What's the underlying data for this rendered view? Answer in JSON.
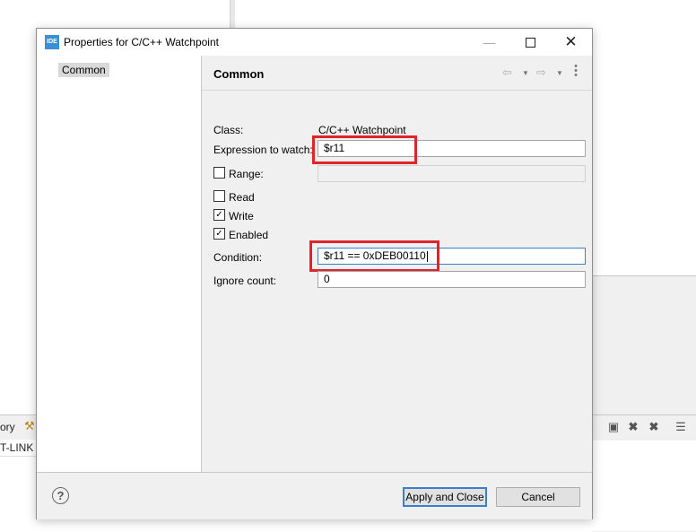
{
  "background": {
    "left_tab_label": "ory",
    "left_list_text": "T-LINK G",
    "right_toolbar_icons": [
      "terminate-icon",
      "remove-icon",
      "remove-all-icon",
      "view-menu-icon"
    ]
  },
  "dialog": {
    "app_icon_text": "IDE",
    "title": "Properties for C/C++ Watchpoint",
    "window_controls": {
      "minimize": "—",
      "close": "✕"
    },
    "sidebar": {
      "items": [
        {
          "label": "Common",
          "selected": true
        }
      ]
    },
    "content": {
      "title": "Common",
      "nav": {
        "back": "⇦",
        "forward": "⇨",
        "dropdown": "▼",
        "menu": "⋮"
      },
      "class_label": "Class:",
      "class_value": "C/C++ Watchpoint",
      "expression_label": "Expression to watch:",
      "expression_value": "$r11",
      "range_label": "Range:",
      "range_checked": false,
      "range_value": "",
      "read_label": "Read",
      "read_checked": false,
      "write_label": "Write",
      "write_checked": true,
      "enabled_label": "Enabled",
      "enabled_checked": true,
      "condition_label": "Condition:",
      "condition_value": "$r11 == 0xDEB00110",
      "ignore_label": "Ignore count:",
      "ignore_value": "0"
    },
    "footer": {
      "help": "?",
      "apply_label": "Apply and Close",
      "cancel_label": "Cancel"
    },
    "highlight_color": "#e0242b",
    "accent_color": "#3c7fc8"
  }
}
